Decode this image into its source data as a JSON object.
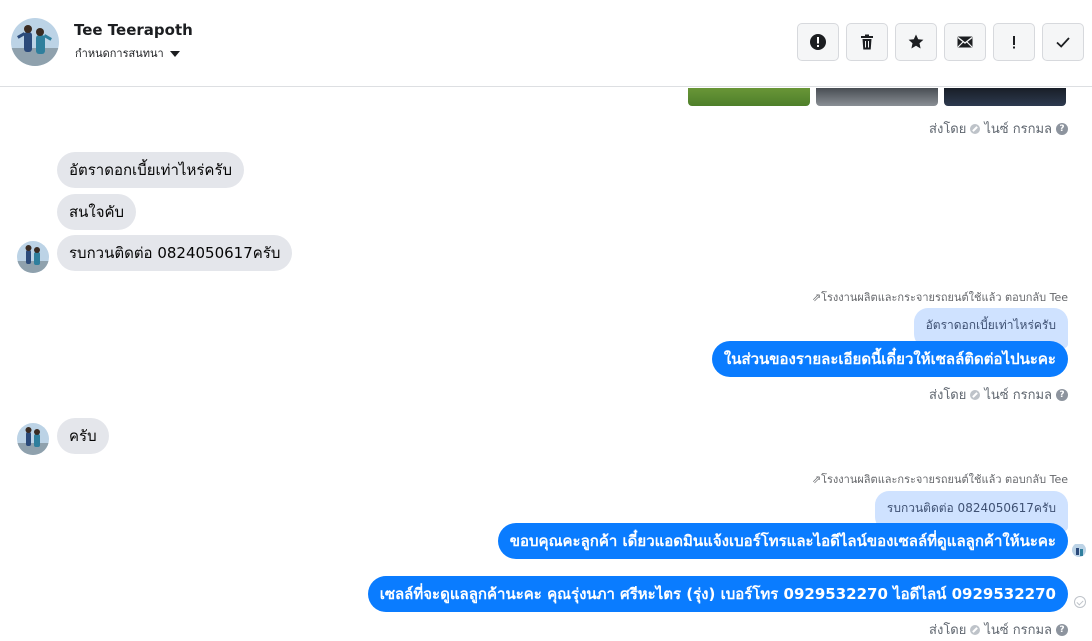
{
  "header": {
    "contact_name": "Tee Teerapoth",
    "assign_label": "กำหนดการสนทนา",
    "toolbar": [
      {
        "name": "alert-button",
        "icon": "alert-circle-icon"
      },
      {
        "name": "delete-button",
        "icon": "trash-icon"
      },
      {
        "name": "star-button",
        "icon": "star-icon"
      },
      {
        "name": "mark-unread-button",
        "icon": "envelope-icon"
      },
      {
        "name": "important-button",
        "icon": "exclamation-icon"
      },
      {
        "name": "mark-done-button",
        "icon": "checkmark-icon"
      }
    ]
  },
  "thread": {
    "sent_by_1": {
      "prefix": "ส่งโดย",
      "sender": "ไนซ์ กรกมล"
    },
    "incoming_1": [
      "อัตราดอกเบี้ยเท่าไหร่ครับ",
      "สนใจคับ",
      "รบกวนติดต่อ 0824050617ครับ"
    ],
    "reply_1": {
      "meta": "โรงงานผลิตและกระจายรถยนต์ใช้แล้ว ตอบกลับ Tee",
      "quoted": "อัตราดอกเบี้ยเท่าไหร่ครับ",
      "text": "ในส่วนของรายละเอียดนี้เดี๋ยวให้เซลล์ติดต่อไปนะคะ"
    },
    "sent_by_2": {
      "prefix": "ส่งโดย",
      "sender": "ไนซ์ กรกมล"
    },
    "incoming_2": "ครับ",
    "reply_2": {
      "meta": "โรงงานผลิตและกระจายรถยนต์ใช้แล้ว ตอบกลับ Tee",
      "quoted": "รบกวนติดต่อ 0824050617ครับ",
      "text": "ขอบคุณคะลูกค้า เดี๋ยวแอดมินแจ้งเบอร์โทรและไอดีไลน์ของเซลล์ที่ดูแลลูกค้าให้นะคะ"
    },
    "outgoing_3": "เซลล์ที่จะดูแลลูกค้านะคะ คุณรุ่งนภา ศรีหะไตร (รุ่ง) เบอร์โทร 0929532270 ไอดีไลน์ 0929532270",
    "sent_by_3": {
      "prefix": "ส่งโดย",
      "sender": "ไนซ์ กรกมล"
    }
  },
  "colors": {
    "outgoing_bubble": "#0a7cff",
    "incoming_bubble": "#e4e6eb",
    "quote_bubble": "#cfe2ff"
  }
}
